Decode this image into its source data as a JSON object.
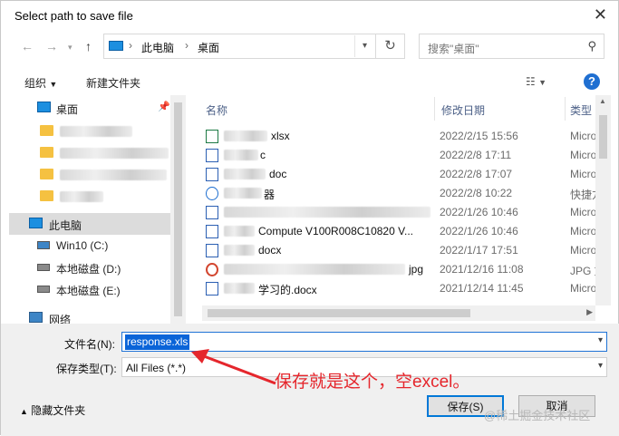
{
  "window": {
    "title": "Select path to save file"
  },
  "address": {
    "crumbs": [
      "此电脑",
      "桌面"
    ],
    "search_placeholder": "搜索\"桌面\""
  },
  "toolbar": {
    "organize": "组织",
    "new_folder": "新建文件夹",
    "help": "?"
  },
  "nav": {
    "desktop": "桌面",
    "this_pc": "此电脑",
    "drives": [
      "Win10 (C:)",
      "本地磁盘 (D:)",
      "本地磁盘 (E:)"
    ],
    "network": "网络"
  },
  "columns": {
    "name": "名称",
    "modified": "修改日期",
    "type": "类型"
  },
  "files": [
    {
      "name": "xlsx",
      "date": "2022/2/15 15:56",
      "type": "Micro",
      "icon": "excel-file-icon"
    },
    {
      "name": "c",
      "date": "2022/2/8 17:11",
      "type": "Micro",
      "icon": "word-file-icon"
    },
    {
      "name": "doc",
      "date": "2022/2/8 17:07",
      "type": "Micro",
      "icon": "word-file-icon"
    },
    {
      "name": "器",
      "date": "2022/2/8 10:22",
      "type": "快捷方",
      "icon": "shortcut-icon"
    },
    {
      "name": "",
      "date": "2022/1/26 10:46",
      "type": "Micro",
      "icon": "word-file-icon"
    },
    {
      "name": "Compute V100R008C10820 V...",
      "date": "2022/1/26 10:46",
      "type": "Micro",
      "icon": "word-file-icon"
    },
    {
      "name": "docx",
      "date": "2022/1/17 17:51",
      "type": "Micro",
      "icon": "word-file-icon"
    },
    {
      "name": "jpg",
      "date": "2021/12/16 11:08",
      "type": "JPG 文",
      "icon": "image-file-icon"
    },
    {
      "name": "学习的.docx",
      "date": "2021/12/14 11:45",
      "type": "Micro",
      "icon": "word-file-icon"
    }
  ],
  "form": {
    "filename_label": "文件名(N):",
    "filename_value": "response.xls",
    "type_label": "保存类型(T):",
    "type_value": "All Files (*.*)",
    "hide_folders": "隐藏文件夹",
    "save": "保存(S)",
    "cancel": "取消"
  },
  "annotation": "保存就是这个，空excel。",
  "watermark": "@稀土掘金技术社区",
  "colors": {
    "accent": "#0078d7",
    "annotation": "#e5262c",
    "selection": "#0a64d8"
  }
}
